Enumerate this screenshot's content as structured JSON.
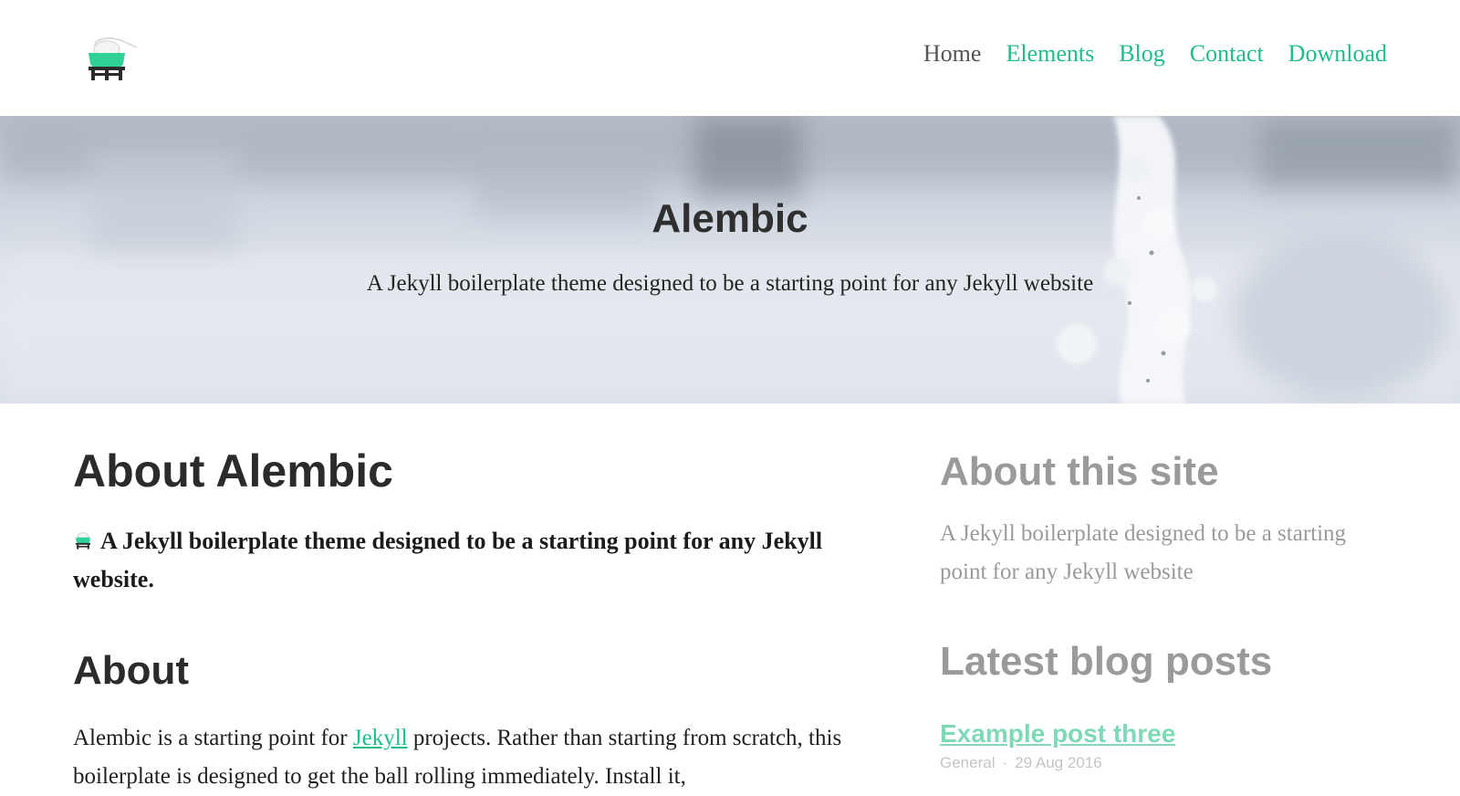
{
  "nav": {
    "items": [
      {
        "label": "Home",
        "current": true
      },
      {
        "label": "Elements",
        "current": false
      },
      {
        "label": "Blog",
        "current": false
      },
      {
        "label": "Contact",
        "current": false
      },
      {
        "label": "Download",
        "current": false
      }
    ]
  },
  "hero": {
    "title": "Alembic",
    "subtitle": "A Jekyll boilerplate theme designed to be a starting point for any Jekyll website"
  },
  "main": {
    "heading": "About Alembic",
    "lead": "A Jekyll boilerplate theme designed to be a starting point for any Jekyll website.",
    "about_heading": "About",
    "about_before_link": "Alembic is a starting point for ",
    "about_link": "Jekyll",
    "about_after_link": " projects. Rather than starting from scratch, this boilerplate is designed to get the ball rolling immediately. Install it,"
  },
  "sidebar": {
    "about_heading": "About this site",
    "about_text": "A Jekyll boilerplate designed to be a starting point for any Jekyll website",
    "latest_heading": "Latest blog posts",
    "posts": [
      {
        "title": "Example post three",
        "category": "General",
        "separator": "·",
        "date": "29 Aug 2016"
      }
    ]
  },
  "colors": {
    "accent": "#1fbd85",
    "nav_current": "#555555",
    "sidebar_text": "#9a9a9a"
  },
  "icons": {
    "logo": "alembic-flask-icon"
  }
}
